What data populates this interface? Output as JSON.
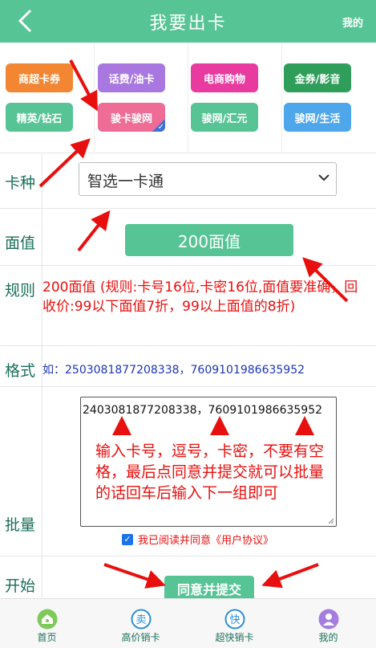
{
  "header": {
    "title": "我要出卡",
    "right_link": "我的"
  },
  "categories": [
    {
      "label": "商超卡券",
      "color": "#f28633"
    },
    {
      "label": "话费/油卡",
      "color": "#a877e0"
    },
    {
      "label": "电商购物",
      "color": "#e93aa0"
    },
    {
      "label": "金券/影音",
      "color": "#2f9e5a"
    },
    {
      "label": "精英/钻石",
      "color": "#56c495"
    },
    {
      "label": "骏卡骏网",
      "color": "#ee6c96",
      "selected": true
    },
    {
      "label": "骏网/汇元",
      "color": "#56c495"
    },
    {
      "label": "骏网/生活",
      "color": "#4da7ea"
    }
  ],
  "form": {
    "card_type_label": "卡种",
    "card_type_value": "智选一卡通",
    "face_label": "面值",
    "face_value": "200面值",
    "rules_label": "规则",
    "rules_text": "200面值    (规则:卡号16位,卡密16位,面值要准确，回收价:99以下面值7折，99以上面值的8折)",
    "format_label": "格式",
    "format_text": "如：2503081877208338，7609101986635952",
    "batch_label": "批量",
    "batch_value": "2403081877208338，7609101986635952",
    "batch_hint": "输入卡号，逗号，卡密，不要有空格，最后点同意并提交就可以批量的话回车后输入下一组即可",
    "agree_text": "我已阅读并同意《用户协议》",
    "agree_checked": true,
    "start_label": "开始",
    "submit_label": "同意并提交"
  },
  "tabbar": [
    {
      "label": "首页",
      "icon": "home-icon"
    },
    {
      "label": "高价销卡",
      "icon": "sell-high-icon",
      "glyph": "卖"
    },
    {
      "label": "超快销卡",
      "icon": "fast-sell-icon",
      "glyph": "快"
    },
    {
      "label": "我的",
      "icon": "user-icon"
    }
  ],
  "colors": {
    "brand": "#56c495",
    "alert": "#e8100e",
    "link": "#1c35b5"
  }
}
